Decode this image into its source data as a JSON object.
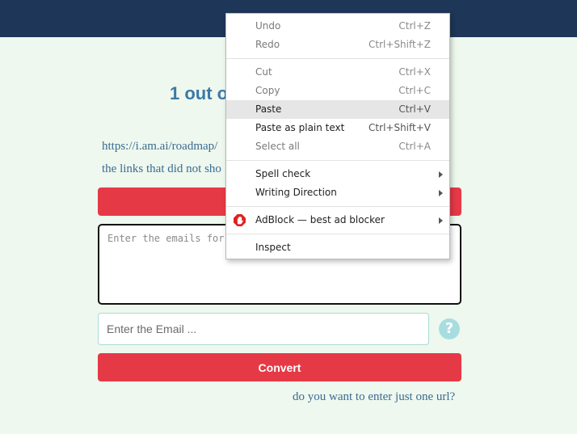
{
  "page": {
    "heading": "1 out o",
    "url_line_1": "https://i.am.ai/roadmap/",
    "url_line_2": "the links that did not sho",
    "emails_placeholder": "Enter the emails for",
    "email_placeholder": "Enter the Email ...",
    "help_label": "?",
    "convert_label": "Convert",
    "one_url_link": "do you want to enter just one url?",
    "colors": {
      "topbar": "#1e3658",
      "accent_red": "#e63946",
      "background": "#eef8ee",
      "link": "#3a6b93"
    }
  },
  "context_menu": {
    "items": [
      {
        "label": "Undo",
        "shortcut": "Ctrl+Z",
        "icon": ""
      },
      {
        "label": "Redo",
        "shortcut": "Ctrl+Shift+Z",
        "icon": ""
      },
      {
        "label": "Cut",
        "shortcut": "Ctrl+X",
        "icon": ""
      },
      {
        "label": "Copy",
        "shortcut": "Ctrl+C",
        "icon": ""
      },
      {
        "label": "Paste",
        "shortcut": "Ctrl+V",
        "icon": ""
      },
      {
        "label": "Paste as plain text",
        "shortcut": "Ctrl+Shift+V",
        "icon": ""
      },
      {
        "label": "Select all",
        "shortcut": "Ctrl+A",
        "icon": ""
      },
      {
        "label": "Spell check",
        "shortcut": "",
        "icon": "chevron-right-icon"
      },
      {
        "label": "Writing Direction",
        "shortcut": "",
        "icon": "chevron-right-icon"
      },
      {
        "label": "AdBlock — best ad blocker",
        "shortcut": "",
        "icon": "adblock-hand-icon"
      },
      {
        "label": "Inspect",
        "shortcut": "",
        "icon": ""
      }
    ],
    "highlighted": "Paste"
  }
}
